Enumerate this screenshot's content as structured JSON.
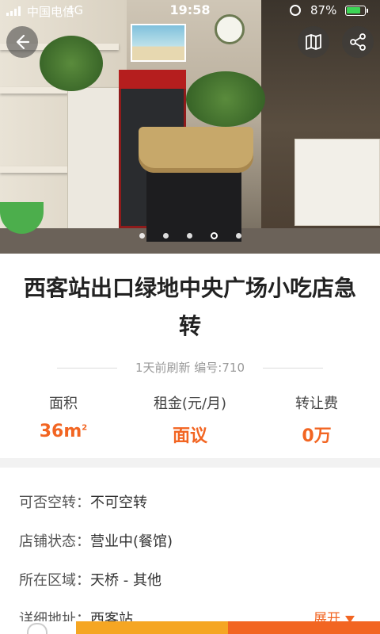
{
  "status_bar": {
    "carrier": "中国电信",
    "network": "4G",
    "time": "19:58",
    "battery": "87%"
  },
  "colors": {
    "accent": "#f26522",
    "secondary": "#f5a623",
    "battery": "#3cd455"
  },
  "header": {
    "back_icon": "back-arrow-icon",
    "map_icon": "map-icon",
    "share_icon": "share-icon"
  },
  "carousel": {
    "total": 5,
    "active": 4
  },
  "listing": {
    "title": "西客站出口绿地中央广场小吃店急转",
    "meta": "1天前刷新 编号:710"
  },
  "stats": [
    {
      "label": "面积",
      "value": "36m",
      "sup": "2"
    },
    {
      "label": "租金(元/月)",
      "value": "面议"
    },
    {
      "label": "转让费",
      "value": "0万"
    }
  ],
  "details": [
    {
      "key": "可否空转：",
      "value": "不可空转"
    },
    {
      "key": "店铺状态：",
      "value": "营业中(餐馆)"
    },
    {
      "key": "所在区域：",
      "value": "天桥 - 其他"
    },
    {
      "key": "详细地址：",
      "value": "西客站"
    }
  ],
  "expand_label": "展开"
}
